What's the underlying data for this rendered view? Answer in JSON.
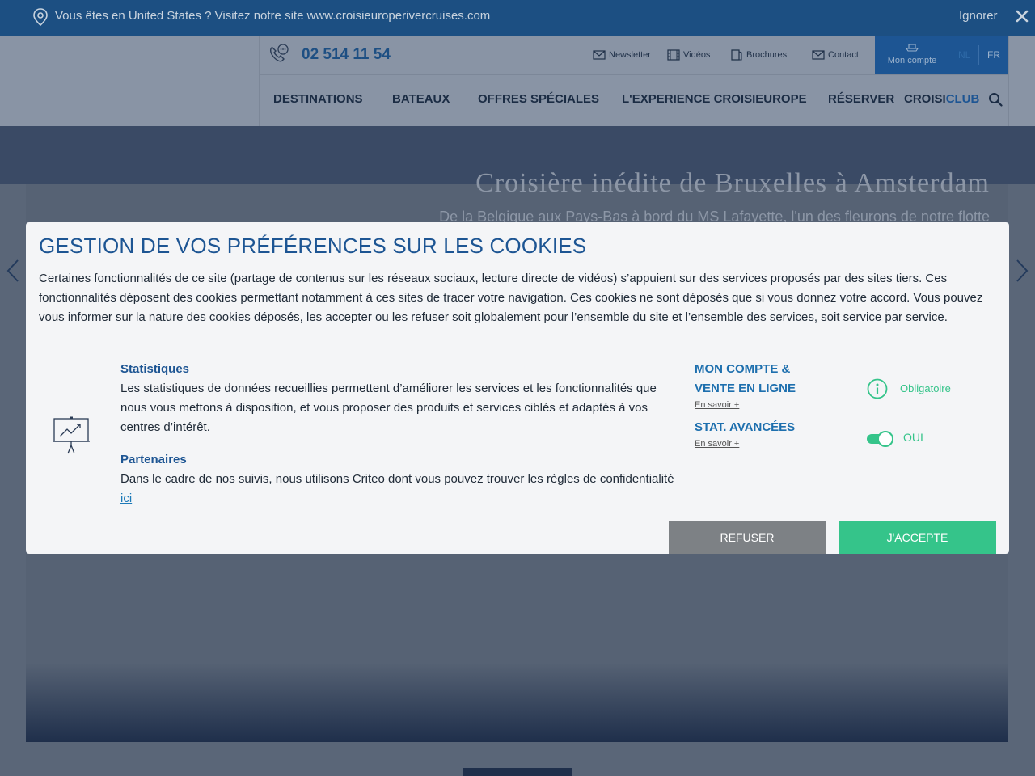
{
  "geo_banner": {
    "message": "Vous êtes en United States ?  Visitez notre site www.croisieuroperivercruises.com",
    "ignore_label": "Ignorer"
  },
  "header": {
    "phone": "02 514 11 54",
    "utility_links": [
      {
        "label": "Newsletter",
        "icon": "envelope-icon"
      },
      {
        "label": "Vidéos",
        "icon": "film-icon"
      },
      {
        "label": "Brochures",
        "icon": "brochure-icon"
      },
      {
        "label": "Contact",
        "icon": "mail-icon"
      }
    ],
    "account_label": "Mon compte",
    "languages": [
      "NL",
      "FR"
    ],
    "nav": [
      "DESTINATIONS",
      "BATEAUX",
      "OFFRES SPÉCIALES",
      "L'EXPERIENCE CROISIEUROPE",
      "RÉSERVER"
    ],
    "club": {
      "part1": "CROISI",
      "part2": "CLUB"
    }
  },
  "hero": {
    "title": "Croisière inédite de Bruxelles à Amsterdam",
    "subtitle": "De la Belgique aux Pays-Bas à bord du MS Lafayette, l'un des fleurons de notre flotte"
  },
  "cookie_modal": {
    "title": "GESTION DE VOS PRÉFÉRENCES SUR LES COOKIES",
    "intro": "Certaines fonctionnalités de ce site (partage de contenus sur les réseaux sociaux, lecture directe de vidéos) s’appuient sur des services proposés par des sites tiers. Ces fonctionnalités déposent des cookies permettant notamment à ces sites de tracer votre navigation. Ces cookies ne sont déposés que si vous donnez votre accord. Vous pouvez vous informer sur la nature des cookies déposés, les accepter ou les refuser soit globalement pour l’ensemble du site et l’ensemble des services, soit service par service.",
    "statistiques_title": "Statistiques",
    "statistiques_text": "Les statistiques de données recueillies permettent d’améliorer les services et les fonctionnalités que nous vous mettons à disposition, et vous proposer des produits et services ciblés et adaptés à vos centres d’intérêt.",
    "partenaires_title": "Partenaires",
    "partenaires_text": "Dans le cadre de nos suivis, nous utilisons Criteo dont vous pouvez trouver les règles de confidentialité",
    "partenaires_link": "ici",
    "services": [
      {
        "line1": "MON COMPTE &",
        "line2": "VENTE EN LIGNE",
        "more": "En savoir +",
        "status": "Obligatoire"
      },
      {
        "line1": "STAT. AVANCÉES",
        "more": "En savoir +",
        "status": "OUI",
        "enabled": true
      }
    ],
    "refuse_label": "REFUSER",
    "accept_label": "J'ACCEPTE",
    "colors": {
      "title": "#1d5593",
      "accept": "#35c48a",
      "refuse": "#7d8185"
    }
  }
}
